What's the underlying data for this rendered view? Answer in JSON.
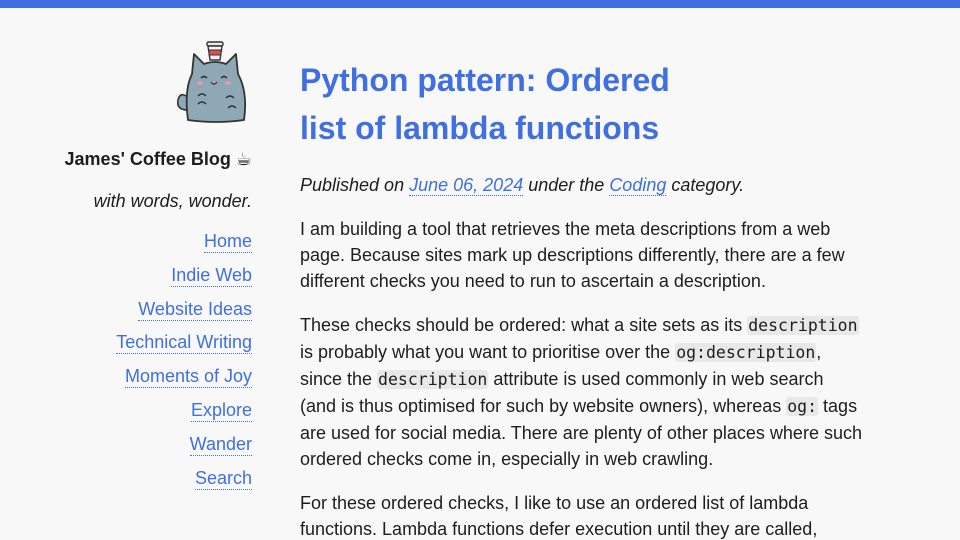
{
  "brand": {
    "accent": "#3f6fe0",
    "background": "#f9f8f8"
  },
  "sidebar": {
    "avatar_icon": "cat-with-coffee-cup-icon",
    "site_title": "James' Coffee Blog ☕",
    "tagline": "with words, wonder.",
    "nav": [
      {
        "label": "Home"
      },
      {
        "label": "Indie Web"
      },
      {
        "label": "Website Ideas"
      },
      {
        "label": "Technical Writing"
      },
      {
        "label": "Moments of Joy"
      },
      {
        "label": "Explore"
      },
      {
        "label": "Wander"
      },
      {
        "label": "Search"
      }
    ]
  },
  "post": {
    "title": "Python pattern: Ordered list of lambda functions",
    "meta": {
      "published_on": "Published on",
      "date": "June 06, 2024",
      "under_the": "under the",
      "category": "Coding",
      "category_suffix": "category."
    },
    "p1": "I am building a tool that retrieves the meta descriptions from a web page. Because sites mark up descriptions differently, there are a few different checks you need to run to ascertain a description.",
    "p2": {
      "t1": "These checks should be ordered: what a site sets as its ",
      "c1": "description",
      "t2": " is probably what you want to prioritise over the ",
      "c2": "og:description",
      "t3": ", since the ",
      "c3": "description",
      "t4": " attribute is used commonly in web search (and is thus optimised for such by website owners), whereas ",
      "c4": "og:",
      "t5": " tags are used for social media. There are plenty of other places where such ordered checks come in, especially in web crawling."
    },
    "p3": "For these ordered checks, I like to use an ordered list of lambda functions. Lambda functions defer execution until they are called,"
  }
}
